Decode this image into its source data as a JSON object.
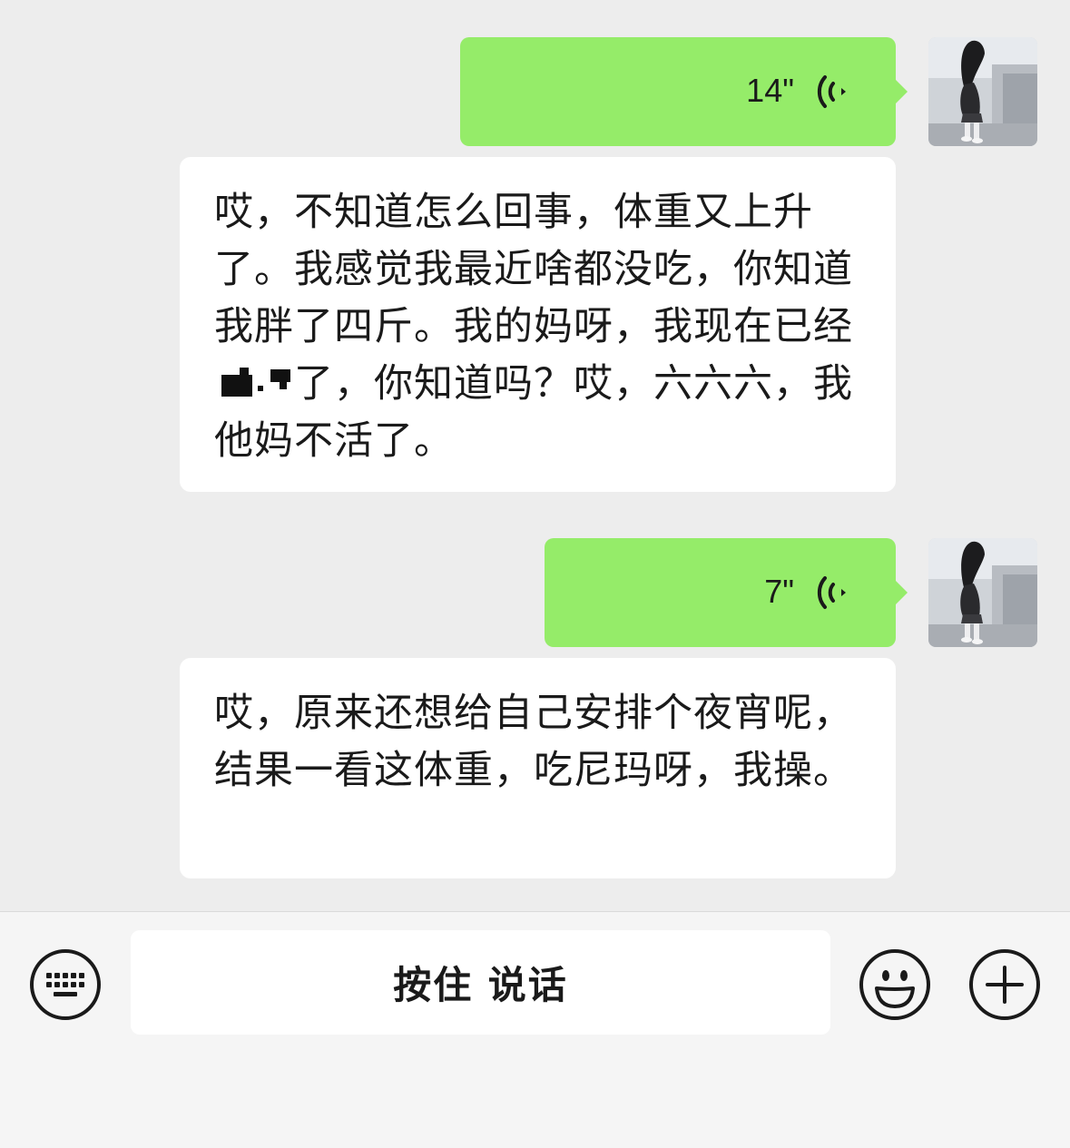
{
  "messages": [
    {
      "type": "voice",
      "duration": "14\"",
      "transcript_part1": "哎，不知道怎么回事，体重又上升了。我感觉我最近啥都没吃，你知道我胖了四斤。我的妈呀，我现在已经",
      "transcript_part2": "了，你知道吗？哎，六六六，我他妈不活了。"
    },
    {
      "type": "voice",
      "duration": "7\"",
      "transcript": "哎，原来还想给自己安排个夜宵呢，结果一看这体重，吃尼玛呀，我操。"
    }
  ],
  "input_bar": {
    "hold_to_talk_label": "按住 说话",
    "left_icon": "keyboard-icon",
    "emoji_icon": "emoji-icon",
    "plus_icon": "plus-icon"
  },
  "colors": {
    "sent_bubble": "#95ec69",
    "transcript_bubble": "#ffffff",
    "chat_background": "#ededed",
    "input_bar": "#f5f5f5"
  }
}
